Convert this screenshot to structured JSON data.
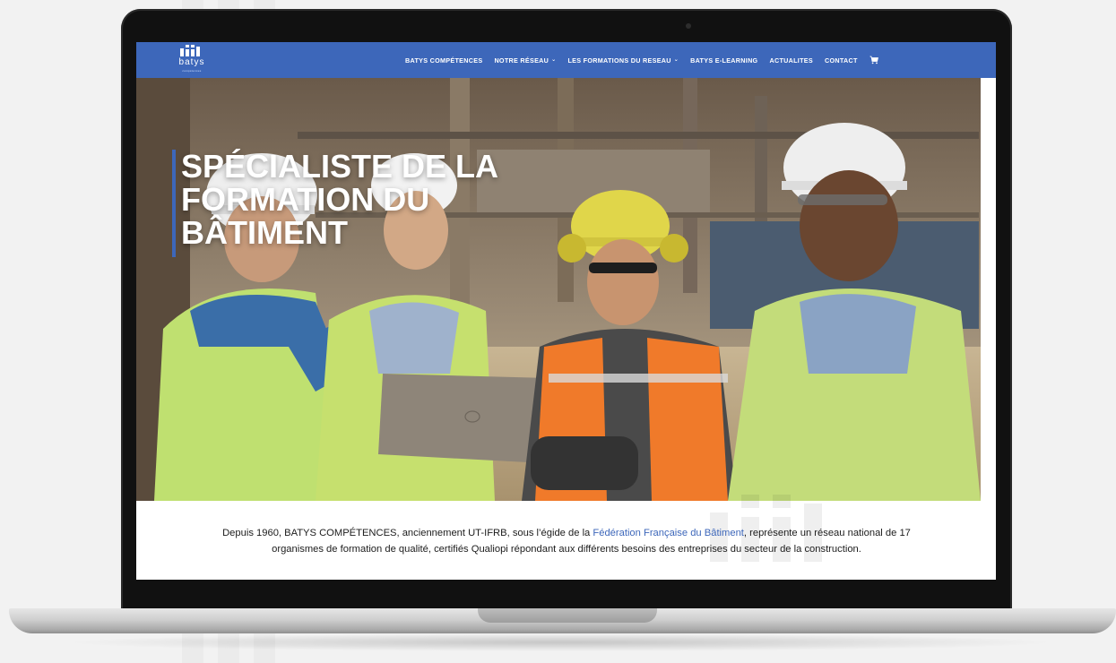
{
  "nav": {
    "logo_text": "batys",
    "logo_subtext": "compétences",
    "items": [
      {
        "label": "BATYS COMPÉTENCES",
        "dropdown": false
      },
      {
        "label": "NOTRE RÉSEAU",
        "dropdown": true
      },
      {
        "label": "LES FORMATIONS DU RESEAU",
        "dropdown": true
      },
      {
        "label": "BATYS E-LEARNING",
        "dropdown": false
      },
      {
        "label": "ACTUALITES",
        "dropdown": false
      },
      {
        "label": "CONTACT",
        "dropdown": false
      }
    ],
    "cart_icon": "cart-icon",
    "dropdown_icon": "chevron-down-icon"
  },
  "hero": {
    "title_lines": [
      "SPÉCIALISTE DE LA",
      "FORMATION DU",
      "BÂTIMENT"
    ]
  },
  "intro": {
    "before_link": "Depuis 1960, BATYS COMPÉTENCES, anciennement UT-IFRB, sous l’égide de la ",
    "link_text": "Fédération Française du Bâtiment",
    "after_link": ", représente un réseau national de 17 organismes de formation de qualité, certifiés Qualiopi répondant aux différents besoins des entreprises du secteur de la construction."
  },
  "colors": {
    "brand_blue": "#3d67ba",
    "body_text": "#1c1c1c"
  }
}
